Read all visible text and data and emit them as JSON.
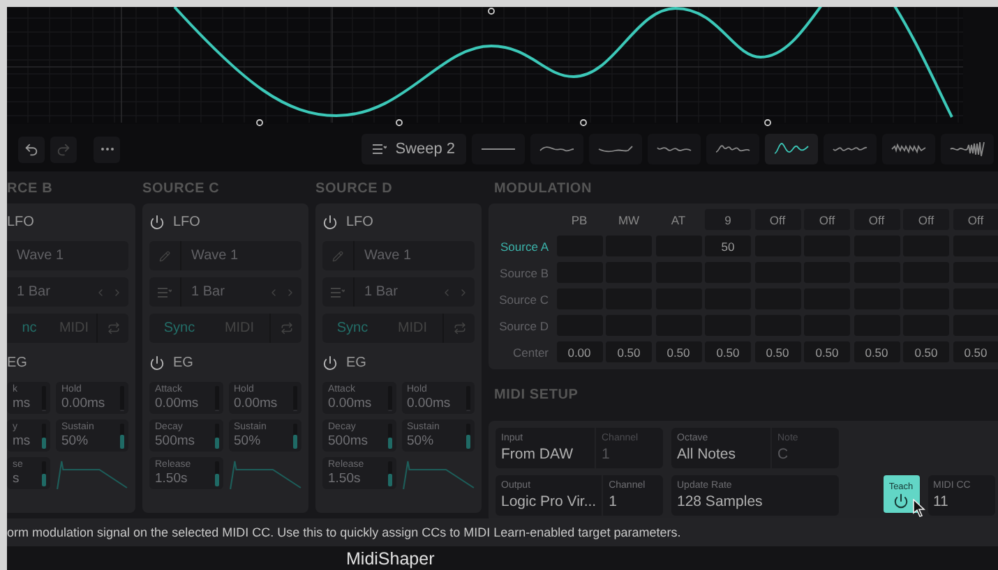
{
  "toolbar": {
    "preset_menu": "Sweep 2",
    "presets": [
      {
        "selected": false
      },
      {
        "selected": false
      },
      {
        "selected": false
      },
      {
        "selected": false
      },
      {
        "selected": false
      },
      {
        "selected": true
      },
      {
        "selected": false
      },
      {
        "selected": false
      },
      {
        "selected": false
      }
    ]
  },
  "sources": [
    {
      "title": "RCE B",
      "cut": true,
      "lfo": "LFO",
      "wave": "Wave 1",
      "rate": "1 Bar",
      "sync": "nc",
      "midi": "MIDI",
      "sync_selected": true,
      "eg": "EG",
      "params": [
        {
          "label": "k",
          "value": "ms",
          "level": 0
        },
        {
          "label": "Hold",
          "value": "0.00ms",
          "level": 0
        },
        {
          "label": "y",
          "value": "ms",
          "level": 0.4
        },
        {
          "label": "Sustain",
          "value": "50%",
          "level": 0.5
        },
        {
          "label": "se",
          "value": "s",
          "level": 0.45
        }
      ]
    },
    {
      "title": "SOURCE C",
      "cut": false,
      "lfo": "LFO",
      "wave": "Wave 1",
      "rate": "1 Bar",
      "sync": "Sync",
      "midi": "MIDI",
      "sync_selected": true,
      "eg": "EG",
      "params": [
        {
          "label": "Attack",
          "value": "0.00ms",
          "level": 0
        },
        {
          "label": "Hold",
          "value": "0.00ms",
          "level": 0
        },
        {
          "label": "Decay",
          "value": "500ms",
          "level": 0.4
        },
        {
          "label": "Sustain",
          "value": "50%",
          "level": 0.5
        },
        {
          "label": "Release",
          "value": "1.50s",
          "level": 0.45
        }
      ]
    },
    {
      "title": "SOURCE D",
      "cut": false,
      "lfo": "LFO",
      "wave": "Wave 1",
      "rate": "1 Bar",
      "sync": "Sync",
      "midi": "MIDI",
      "sync_selected": true,
      "eg": "EG",
      "params": [
        {
          "label": "Attack",
          "value": "0.00ms",
          "level": 0
        },
        {
          "label": "Hold",
          "value": "0.00ms",
          "level": 0
        },
        {
          "label": "Decay",
          "value": "500ms",
          "level": 0.4
        },
        {
          "label": "Sustain",
          "value": "50%",
          "level": 0.5
        },
        {
          "label": "Release",
          "value": "1.50s",
          "level": 0.45
        }
      ]
    }
  ],
  "modulation": {
    "title": "MODULATION",
    "columns": [
      {
        "label": "PB",
        "kind": "fixed"
      },
      {
        "label": "MW",
        "kind": "fixed"
      },
      {
        "label": "AT",
        "kind": "fixed"
      },
      {
        "label": "9",
        "kind": "cc"
      },
      {
        "label": "Off",
        "kind": "cc"
      },
      {
        "label": "Off",
        "kind": "cc"
      },
      {
        "label": "Off",
        "kind": "cc"
      },
      {
        "label": "Off",
        "kind": "cc"
      },
      {
        "label": "Off",
        "kind": "cc"
      }
    ],
    "rows": [
      {
        "label": "Source A",
        "selected": true,
        "cells": [
          null,
          null,
          null,
          "50",
          null,
          null,
          null,
          null,
          null
        ]
      },
      {
        "label": "Source B",
        "selected": false,
        "cells": [
          null,
          null,
          null,
          null,
          null,
          null,
          null,
          null,
          null
        ]
      },
      {
        "label": "Source C",
        "selected": false,
        "cells": [
          null,
          null,
          null,
          null,
          null,
          null,
          null,
          null,
          null
        ]
      },
      {
        "label": "Source D",
        "selected": false,
        "cells": [
          null,
          null,
          null,
          null,
          null,
          null,
          null,
          null,
          null
        ]
      }
    ],
    "center": {
      "label": "Center",
      "values": [
        "0.00",
        "0.50",
        "0.50",
        "0.50",
        "0.50",
        "0.50",
        "0.50",
        "0.50",
        "0.50"
      ]
    }
  },
  "midi_setup": {
    "title": "MIDI SETUP",
    "rows": [
      [
        [
          {
            "label": "Input",
            "value": "From DAW",
            "disabled": false
          },
          {
            "label": "Channel",
            "value": "1",
            "disabled": true
          }
        ],
        [
          {
            "label": "Octave",
            "value": "All Notes",
            "disabled": false
          },
          {
            "label": "Note",
            "value": "C",
            "disabled": true
          }
        ]
      ],
      [
        [
          {
            "label": "Output",
            "value": "Logic Pro Vir...",
            "disabled": false
          },
          {
            "label": "Channel",
            "value": "1",
            "disabled": false
          }
        ],
        [
          {
            "label": "Update Rate",
            "value": "128 Samples",
            "disabled": false
          }
        ]
      ]
    ],
    "teach": {
      "label": "Teach",
      "on": true
    },
    "midi_cc": {
      "label": "MIDI CC",
      "value": "11"
    }
  },
  "status": "orm modulation signal on the selected MIDI CC. Use this to quickly assign CCs to MIDI Learn-enabled target parameters.",
  "footer": "MidiShaper"
}
